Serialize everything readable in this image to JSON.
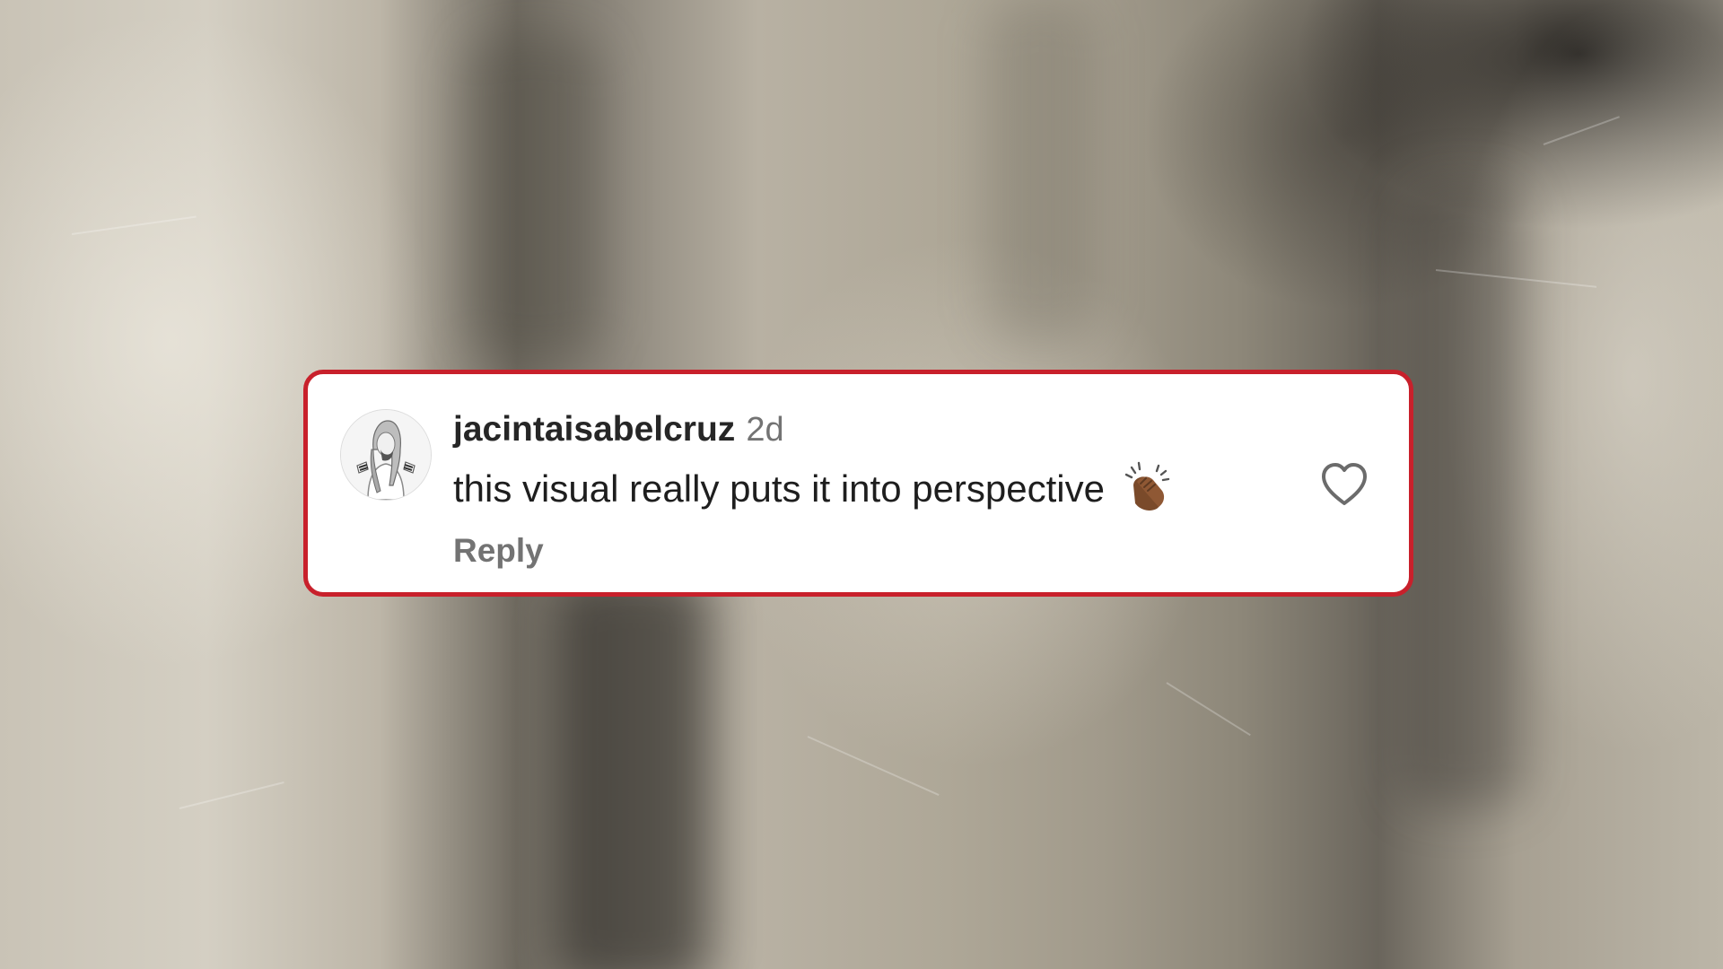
{
  "comment": {
    "username": "jacintaisabelcruz",
    "timestamp": "2d",
    "text": "this visual really puts it into perspective",
    "reaction_icon": "clapping-hands-emoji",
    "reply_label": "Reply",
    "like_icon": "heart-outline-icon",
    "avatar_icon": "sketch-portrait-avatar"
  },
  "colors": {
    "card_border": "#c8202b",
    "card_background": "#ffffff",
    "username": "#262626",
    "secondary_text": "#737373"
  }
}
